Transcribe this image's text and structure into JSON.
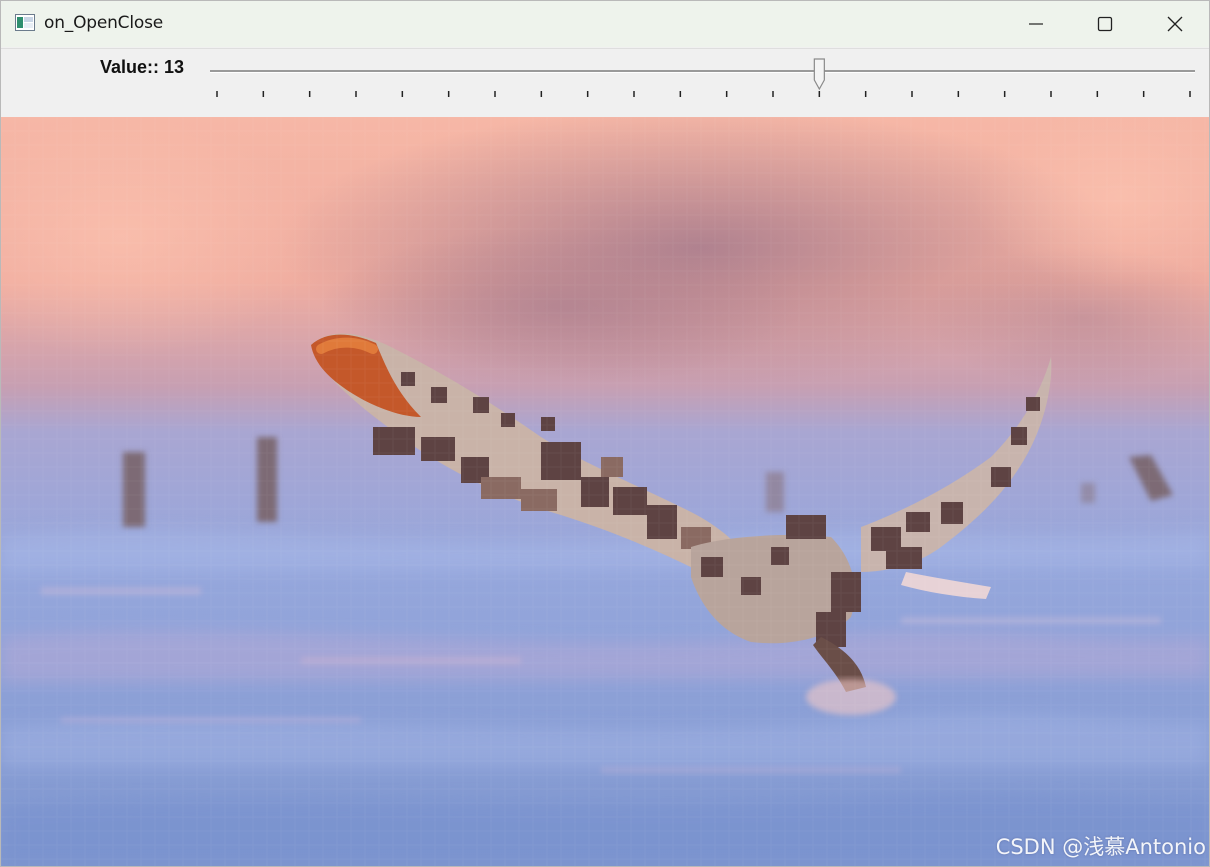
{
  "window": {
    "title": "on_OpenClose",
    "controls": {
      "minimize": "minimize-icon",
      "maximize": "maximize-icon",
      "close": "close-icon"
    }
  },
  "trackbar": {
    "label": "Value:: 13",
    "value": 13,
    "min": 0,
    "max": 21
  },
  "image": {
    "description_icon": "owl-photo",
    "watermark": "CSDN @浅慕Antonio"
  },
  "colors": {
    "titlebar": "#eef3ec",
    "panel": "#f0f0f0",
    "sky": "#f4b6a6",
    "snow": "#8d9ed3"
  }
}
